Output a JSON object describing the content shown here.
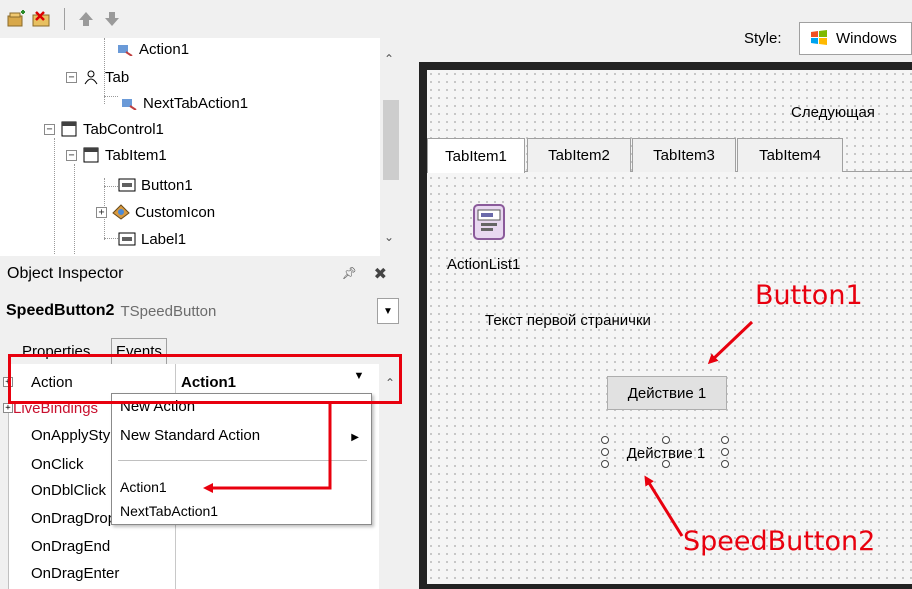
{
  "structure": {
    "tree": [
      {
        "label": "Action1"
      },
      {
        "label": "Tab"
      },
      {
        "label": "NextTabAction1"
      },
      {
        "label": "TabControl1"
      },
      {
        "label": "TabItem1"
      },
      {
        "label": "Button1"
      },
      {
        "label": "CustomIcon"
      },
      {
        "label": "Label1"
      }
    ]
  },
  "object_inspector": {
    "title": "Object Inspector",
    "selected_name": "SpeedButton2",
    "selected_type": "TSpeedButton",
    "tabs": [
      "Properties",
      "Events"
    ],
    "rows": [
      {
        "name": "Action",
        "value": "Action1"
      },
      {
        "name": "LiveBindings",
        "value": ""
      },
      {
        "name": "OnApplyStyleLookup",
        "value": ""
      },
      {
        "name": "OnClick",
        "value": ""
      },
      {
        "name": "OnDblClick",
        "value": ""
      },
      {
        "name": "OnDragDrop",
        "value": ""
      },
      {
        "name": "OnDragEnd",
        "value": ""
      },
      {
        "name": "OnDragEnter",
        "value": ""
      }
    ],
    "dropdown_menu": {
      "items": [
        "New Action",
        "New Standard Action",
        "Action1",
        "NextTabAction1"
      ]
    }
  },
  "designer": {
    "style_label": "Style:",
    "style_value": "Windows",
    "next_label": "Следующая",
    "tabs": [
      "TabItem1",
      "TabItem2",
      "TabItem3",
      "TabItem4"
    ],
    "actionlist_label": "ActionList1",
    "page_text": "Текст первой странички",
    "button1_label": "Действие 1",
    "speedbutton2_label": "Действие 1"
  },
  "annotations": {
    "button1": "Button1",
    "speedbutton2": "SpeedButton2",
    "color": "#e8000e"
  }
}
